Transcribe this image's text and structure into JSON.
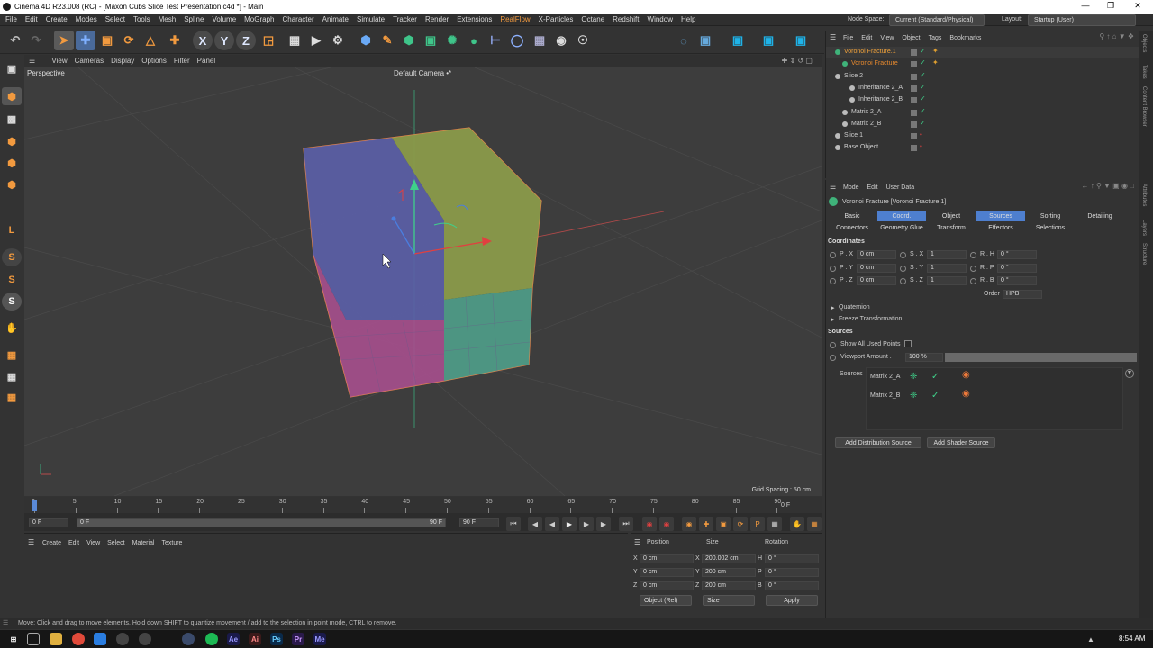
{
  "window": {
    "title": "Cinema 4D R23.008 (RC) - [Maxon Cubs Slice Test Presentation.c4d *] - Main",
    "minimize": "—",
    "maximize": "❐",
    "close": "✕"
  },
  "menu": {
    "items": [
      "File",
      "Edit",
      "Create",
      "Modes",
      "Select",
      "Tools",
      "Mesh",
      "Spline",
      "Volume",
      "MoGraph",
      "Character",
      "Animate",
      "Simulate",
      "Tracker",
      "Render",
      "Extensions",
      "RealFlow",
      "X-Particles",
      "Octane",
      "Redshift",
      "Window",
      "Help"
    ],
    "node_space_label": "Node Space:",
    "node_space_value": "Current (Standard/Physical)",
    "layout_label": "Layout:",
    "layout_value": "Startup (User)"
  },
  "viewport": {
    "menu": [
      "View",
      "Cameras",
      "Display",
      "Options",
      "Filter",
      "Panel"
    ],
    "name": "Perspective",
    "camera": "Default Camera •*",
    "grid_spacing": "Grid Spacing : 50 cm"
  },
  "timeline": {
    "ticks": [
      "0",
      "5",
      "10",
      "15",
      "20",
      "25",
      "30",
      "35",
      "40",
      "45",
      "50",
      "55",
      "60",
      "65",
      "70",
      "75",
      "80",
      "85",
      "90"
    ],
    "current_end": "0 F",
    "start": "0 F",
    "range_start": "0 F",
    "range_end": "90 F",
    "end": "90 F"
  },
  "material_manager": {
    "menu": [
      "Create",
      "Edit",
      "View",
      "Select",
      "Material",
      "Texture"
    ]
  },
  "coord_manager": {
    "headers": [
      "Position",
      "Size",
      "Rotation"
    ],
    "rows": [
      {
        "axis": "X",
        "pos": "0 cm",
        "size_axis": "X",
        "size": "200.002 cm",
        "rot_axis": "H",
        "rot": "0 °"
      },
      {
        "axis": "Y",
        "pos": "0 cm",
        "size_axis": "Y",
        "size": "200 cm",
        "rot_axis": "P",
        "rot": "0 °"
      },
      {
        "axis": "Z",
        "pos": "0 cm",
        "size_axis": "Z",
        "size": "200 cm",
        "rot_axis": "B",
        "rot": "0 °"
      }
    ],
    "mode": "Object (Rel)",
    "size_mode": "Size",
    "apply": "Apply"
  },
  "status": "Move: Click and drag to move elements. Hold down SHIFT to quantize movement / add to the selection in point mode, CTRL to remove.",
  "objects": {
    "menu": [
      "File",
      "Edit",
      "View",
      "Object",
      "Tags",
      "Bookmarks"
    ],
    "items": [
      {
        "name": "Voronoi Fracture.1",
        "indent": 0,
        "color": "#f2a33a"
      },
      {
        "name": "Voronoi Fracture",
        "indent": 1,
        "color": "#e88a2e"
      },
      {
        "name": "Slice 2",
        "indent": 0,
        "color": "#cfcfcf"
      },
      {
        "name": "Inheritance 2_A",
        "indent": 2,
        "color": "#cfcfcf"
      },
      {
        "name": "Inheritance 2_B",
        "indent": 2,
        "color": "#cfcfcf"
      },
      {
        "name": "Matrix 2_A",
        "indent": 1,
        "color": "#cfcfcf"
      },
      {
        "name": "Matrix 2_B",
        "indent": 1,
        "color": "#cfcfcf"
      },
      {
        "name": "Slice 1",
        "indent": 0,
        "color": "#cfcfcf"
      },
      {
        "name": "Base Object",
        "indent": 0,
        "color": "#cfcfcf"
      }
    ]
  },
  "attributes": {
    "menu": [
      "Mode",
      "Edit",
      "User Data"
    ],
    "object": "Voronoi Fracture [Voronoi Fracture.1]",
    "tabs1": [
      "Basic",
      "Coord.",
      "Object",
      "Sources",
      "Sorting",
      "Detailing"
    ],
    "tabs2": [
      "Connectors",
      "Geometry Glue",
      "Transform",
      "Effectors",
      "Selections"
    ],
    "coordinates_title": "Coordinates",
    "coords": [
      {
        "a": "P . X",
        "av": "0 cm",
        "b": "S . X",
        "bv": "1",
        "c": "R . H",
        "cv": "0 °"
      },
      {
        "a": "P . Y",
        "av": "0 cm",
        "b": "S . Y",
        "bv": "1",
        "c": "R . P",
        "cv": "0 °"
      },
      {
        "a": "P . Z",
        "av": "0 cm",
        "b": "S . Z",
        "bv": "1",
        "c": "R . B",
        "cv": "0 °"
      }
    ],
    "order_label": "Order",
    "order_value": "HPB",
    "quaternion": "Quaternion",
    "freeze": "Freeze Transformation",
    "sources_title": "Sources",
    "show_all": "Show All Used Points",
    "viewport_amount": "Viewport Amount . .",
    "viewport_value": "100 %",
    "viewport_fraction": 1.0,
    "sources_label": "Sources",
    "source_items": [
      "Matrix 2_A",
      "Matrix 2_B"
    ],
    "add_distribution": "Add Distribution Source",
    "add_shader": "Add Shader Source"
  },
  "side_tabs": [
    "Objects",
    "Takes",
    "Content Browser",
    "Attributes",
    "Layers",
    "Structure"
  ],
  "clock": "8:54 AM",
  "colors": {
    "accent": "#f29a3f",
    "selected_tab": "#4e7fcf"
  }
}
